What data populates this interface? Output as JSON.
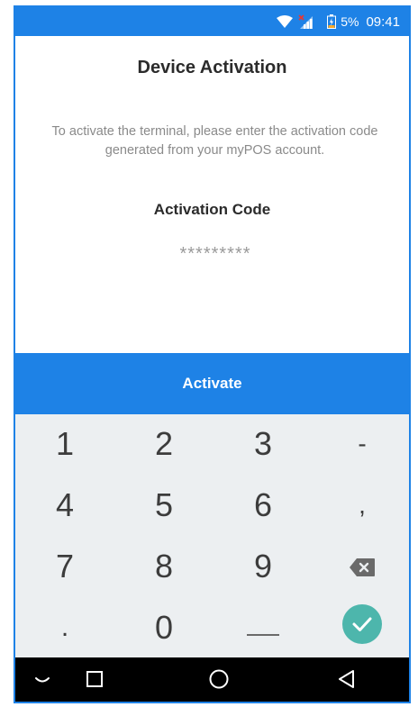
{
  "status_bar": {
    "battery_percent": "5%",
    "time": "09:41",
    "icons": [
      "wifi-icon",
      "no-signal-icon",
      "battery-low-icon"
    ]
  },
  "screen": {
    "title": "Device Activation",
    "description": "To activate the terminal, please enter the activation code generated from your myPOS account.",
    "code_label": "Activation Code",
    "code_placeholder": "*********",
    "activate_label": "Activate"
  },
  "keypad": {
    "keys": [
      "1",
      "2",
      "3",
      "-",
      "4",
      "5",
      "6",
      ",",
      "7",
      "8",
      "9",
      "backspace",
      ".",
      "0",
      "_",
      "confirm"
    ],
    "digit_1": "1",
    "digit_2": "2",
    "digit_3": "3",
    "dash": "-",
    "digit_4": "4",
    "digit_5": "5",
    "digit_6": "6",
    "comma": ",",
    "digit_7": "7",
    "digit_8": "8",
    "digit_9": "9",
    "dot": ".",
    "digit_0": "0"
  },
  "navigation": {
    "buttons": [
      "hide-keyboard-icon",
      "recents-icon",
      "home-icon",
      "back-icon"
    ]
  },
  "colors": {
    "accent": "#1e82e6",
    "confirm": "#4db6ac",
    "keypad_bg": "#eceff1"
  }
}
